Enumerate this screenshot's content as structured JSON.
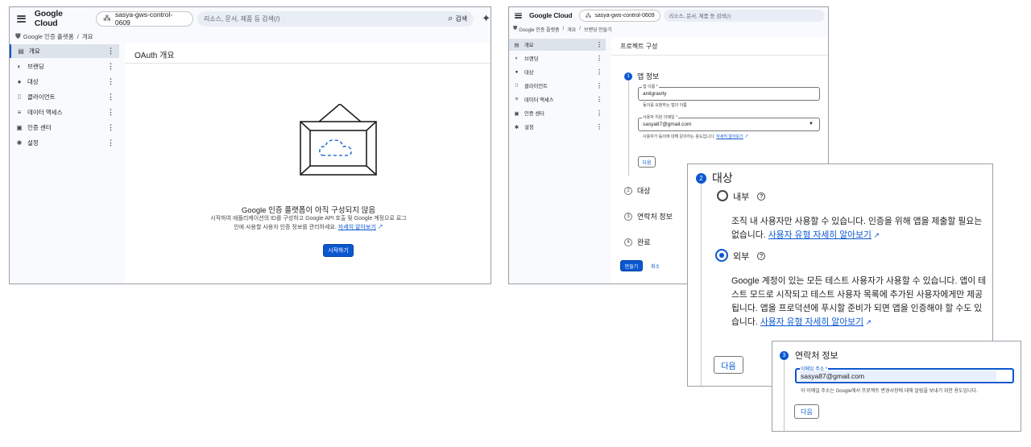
{
  "left": {
    "logo": "Google Cloud",
    "project": "sasya-gws-control-0609",
    "search_placeholder": "리소스, 문서, 제품 등 검색(/)",
    "search_button": "검색",
    "breadcrumb": [
      "Google 인증 플랫폼",
      "/",
      "개요"
    ],
    "nav": [
      {
        "label": "개요",
        "icon": "dashboard-icon",
        "glyph": "▤"
      },
      {
        "label": "브랜딩",
        "icon": "palette-icon",
        "glyph": "◐"
      },
      {
        "label": "대상",
        "icon": "person-icon",
        "glyph": "●"
      },
      {
        "label": "클라이언트",
        "icon": "grid-icon",
        "glyph": "⁞⁞"
      },
      {
        "label": "데이터 액세스",
        "icon": "data-access-icon",
        "glyph": "≡"
      },
      {
        "label": "인증 센터",
        "icon": "verified-icon",
        "glyph": "▣"
      },
      {
        "label": "설정",
        "icon": "gear-icon",
        "glyph": "✱"
      }
    ],
    "page_title": "OAuth 개요",
    "empty_title": "Google 인증 플랫폼이 아직 구성되지 않음",
    "empty_line1": "시작하여 애플리케이션의 ID를 구성하고 Google API 호출 및 Google 계정으로 로그",
    "empty_line2": "인에 사용할 사용자 인증 정보를 관리하세요.",
    "learn_more": "자세히 알아보기",
    "start_button": "시작하기"
  },
  "right": {
    "logo": "Google Cloud",
    "project": "sasya-gws-control-0609",
    "search_placeholder": "리소스, 문서, 제품 등 검색(/)",
    "breadcrumb": [
      "Google 인증 플랫폼",
      "/",
      "개요",
      "/",
      "브랜딩 만들기"
    ],
    "nav": [
      {
        "label": "개요",
        "icon": "dashboard-icon",
        "glyph": "▤"
      },
      {
        "label": "브랜딩",
        "icon": "palette-icon",
        "glyph": "◐"
      },
      {
        "label": "대상",
        "icon": "person-icon",
        "glyph": "●"
      },
      {
        "label": "클라이언트",
        "icon": "grid-icon",
        "glyph": "⁞⁞"
      },
      {
        "label": "데이터 액세스",
        "icon": "data-access-icon",
        "glyph": "≡"
      },
      {
        "label": "인증 센터",
        "icon": "verified-icon",
        "glyph": "▣"
      },
      {
        "label": "설정",
        "icon": "gear-icon",
        "glyph": "✱"
      }
    ],
    "page_title": "프로젝트 구성",
    "step1": {
      "num": "1",
      "title": "앱 정보"
    },
    "app_name_label": "앱 이름 *",
    "app_name_value": "antigravity",
    "app_name_help": "동의를 요청하는 앱의 이름",
    "email_label": "사용자 지원 이메일 *",
    "email_value": "sasya87@gmail.com",
    "email_help": "사용자가 동의에 대해 문의하는 용도입니다.",
    "email_help_link": "자세히 알아보기",
    "next_button": "다음",
    "step2": {
      "num": "2",
      "title": "대상"
    },
    "step3": {
      "num": "3",
      "title": "연락처 정보"
    },
    "step4": {
      "num": "4",
      "title": "완료"
    },
    "create_button": "만들기",
    "cancel_button": "취소"
  },
  "audience_panel": {
    "num": "2",
    "title": "대상",
    "internal_label": "내부",
    "internal_desc1": "조직 내 사용자만 사용할 수 있습니다. 인증을 위해 앱을 제출할 필요는",
    "internal_desc2_prefix": "없습니다.",
    "internal_link": "사용자 유형 자세히 알아보기",
    "external_label": "외부",
    "external_desc1": "Google 계정이 있는 모든 테스트 사용자가 사용할 수 있습니다. 앱이 테",
    "external_desc2": "스트 모드로 시작되고 테스트 사용자 목록에 추가된 사용자에게만 제공",
    "external_desc3": "됩니다. 앱을 프로덕션에 푸시할 준비가 되면 앱을 인증해야 할 수도 있",
    "external_desc4_prefix": "습니다.",
    "external_link": "사용자 유형 자세히 알아보기",
    "next_button": "다음"
  },
  "contact_panel": {
    "num": "3",
    "title": "연락처 정보",
    "email_label": "이메일 주소 *",
    "email_value": "sasya87@gmail.com",
    "help": "이 이메일 주소는 Google에서 프로젝트 변경사항에 대해 알림을 보내기 위한 용도입니다.",
    "next_button": "다음"
  },
  "colors": {
    "accent": "#0b57d0",
    "nav_active": "#dde3ea",
    "background": "#f8fafd"
  }
}
